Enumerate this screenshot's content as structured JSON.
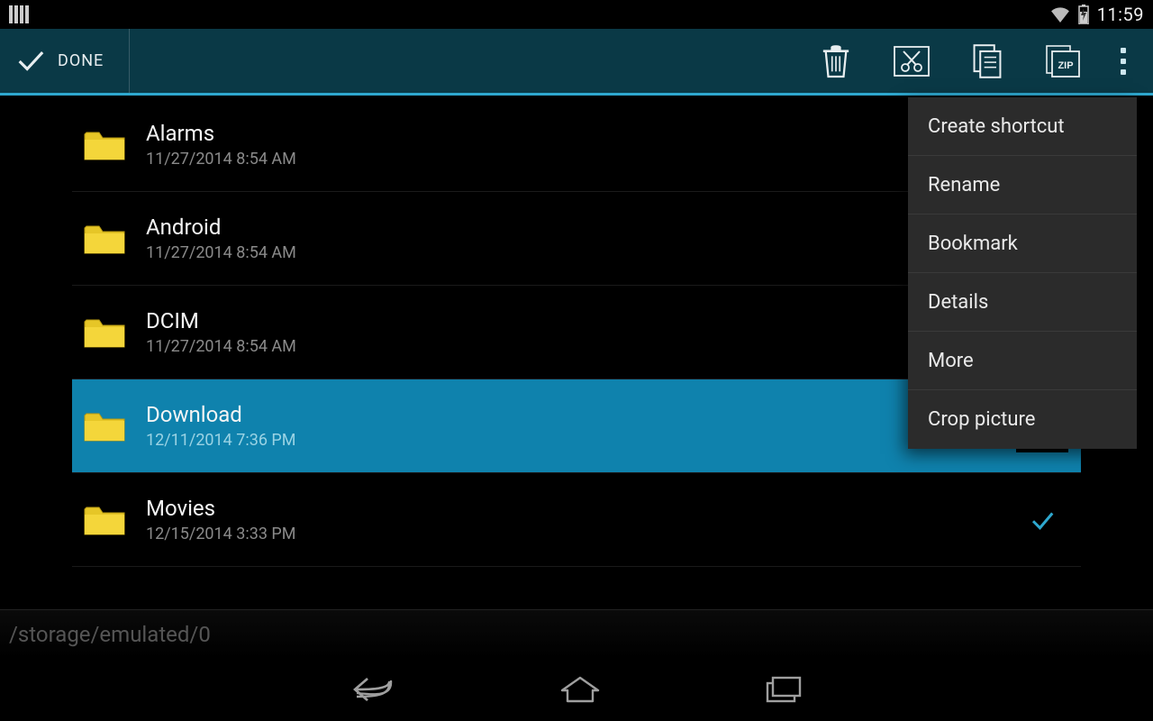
{
  "status": {
    "time": "11:59"
  },
  "actionbar": {
    "done_label": "DONE"
  },
  "files": [
    {
      "name": "Alarms",
      "date": "11/27/2014 8:54 AM",
      "selected": false,
      "checked": false
    },
    {
      "name": "Android",
      "date": "11/27/2014 8:54 AM",
      "selected": false,
      "checked": false
    },
    {
      "name": "DCIM",
      "date": "11/27/2014 8:54 AM",
      "selected": false,
      "checked": false
    },
    {
      "name": "Download",
      "date": "12/11/2014 7:36 PM",
      "selected": true,
      "checked": false
    },
    {
      "name": "Movies",
      "date": "12/15/2014 3:33 PM",
      "selected": false,
      "checked": true
    }
  ],
  "path": "/storage/emulated/0",
  "menu": {
    "items": [
      "Create shortcut",
      "Rename",
      "Bookmark",
      "Details",
      "More",
      "Crop picture"
    ]
  }
}
